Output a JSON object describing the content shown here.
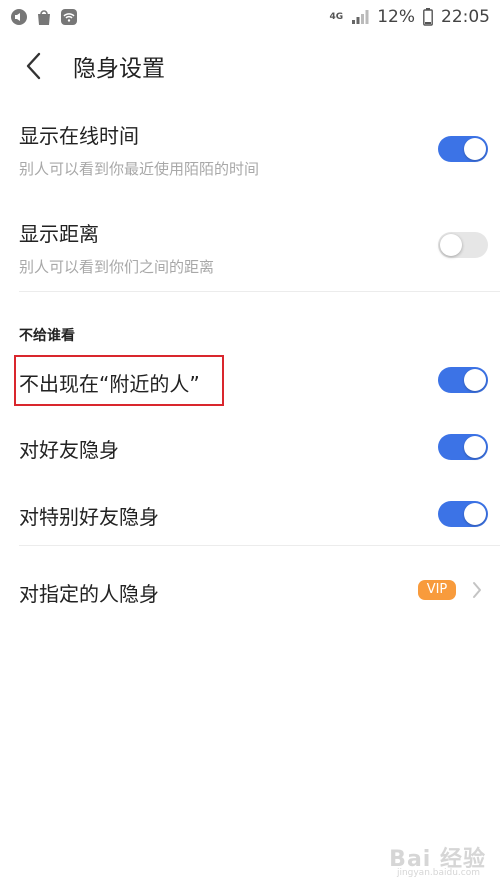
{
  "status_bar": {
    "network": "4G",
    "battery": "12%",
    "time": "22:05"
  },
  "header": {
    "title": "隐身设置"
  },
  "settings": {
    "online_time": {
      "title": "显示在线时间",
      "subtitle": "别人可以看到你最近使用陌陌的时间",
      "enabled": true
    },
    "distance": {
      "title": "显示距离",
      "subtitle": "别人可以看到你们之间的距离",
      "enabled": false
    }
  },
  "hide_from": {
    "label": "不给谁看",
    "items": [
      {
        "title": "不出现在“附近的人”",
        "enabled": true
      },
      {
        "title": "对好友隐身",
        "enabled": true
      },
      {
        "title": "对特别好友隐身",
        "enabled": true
      }
    ]
  },
  "specific_people": {
    "title": "对指定的人隐身",
    "badge": "VIP"
  },
  "watermark": "Bai 经验",
  "watermark_sub": "jingyan.baidu.com",
  "colors": {
    "toggle_on": "#3c73e6",
    "toggle_off": "#e6e6e6",
    "vip_badge": "#f89b3c",
    "highlight_box": "#d9262d"
  }
}
